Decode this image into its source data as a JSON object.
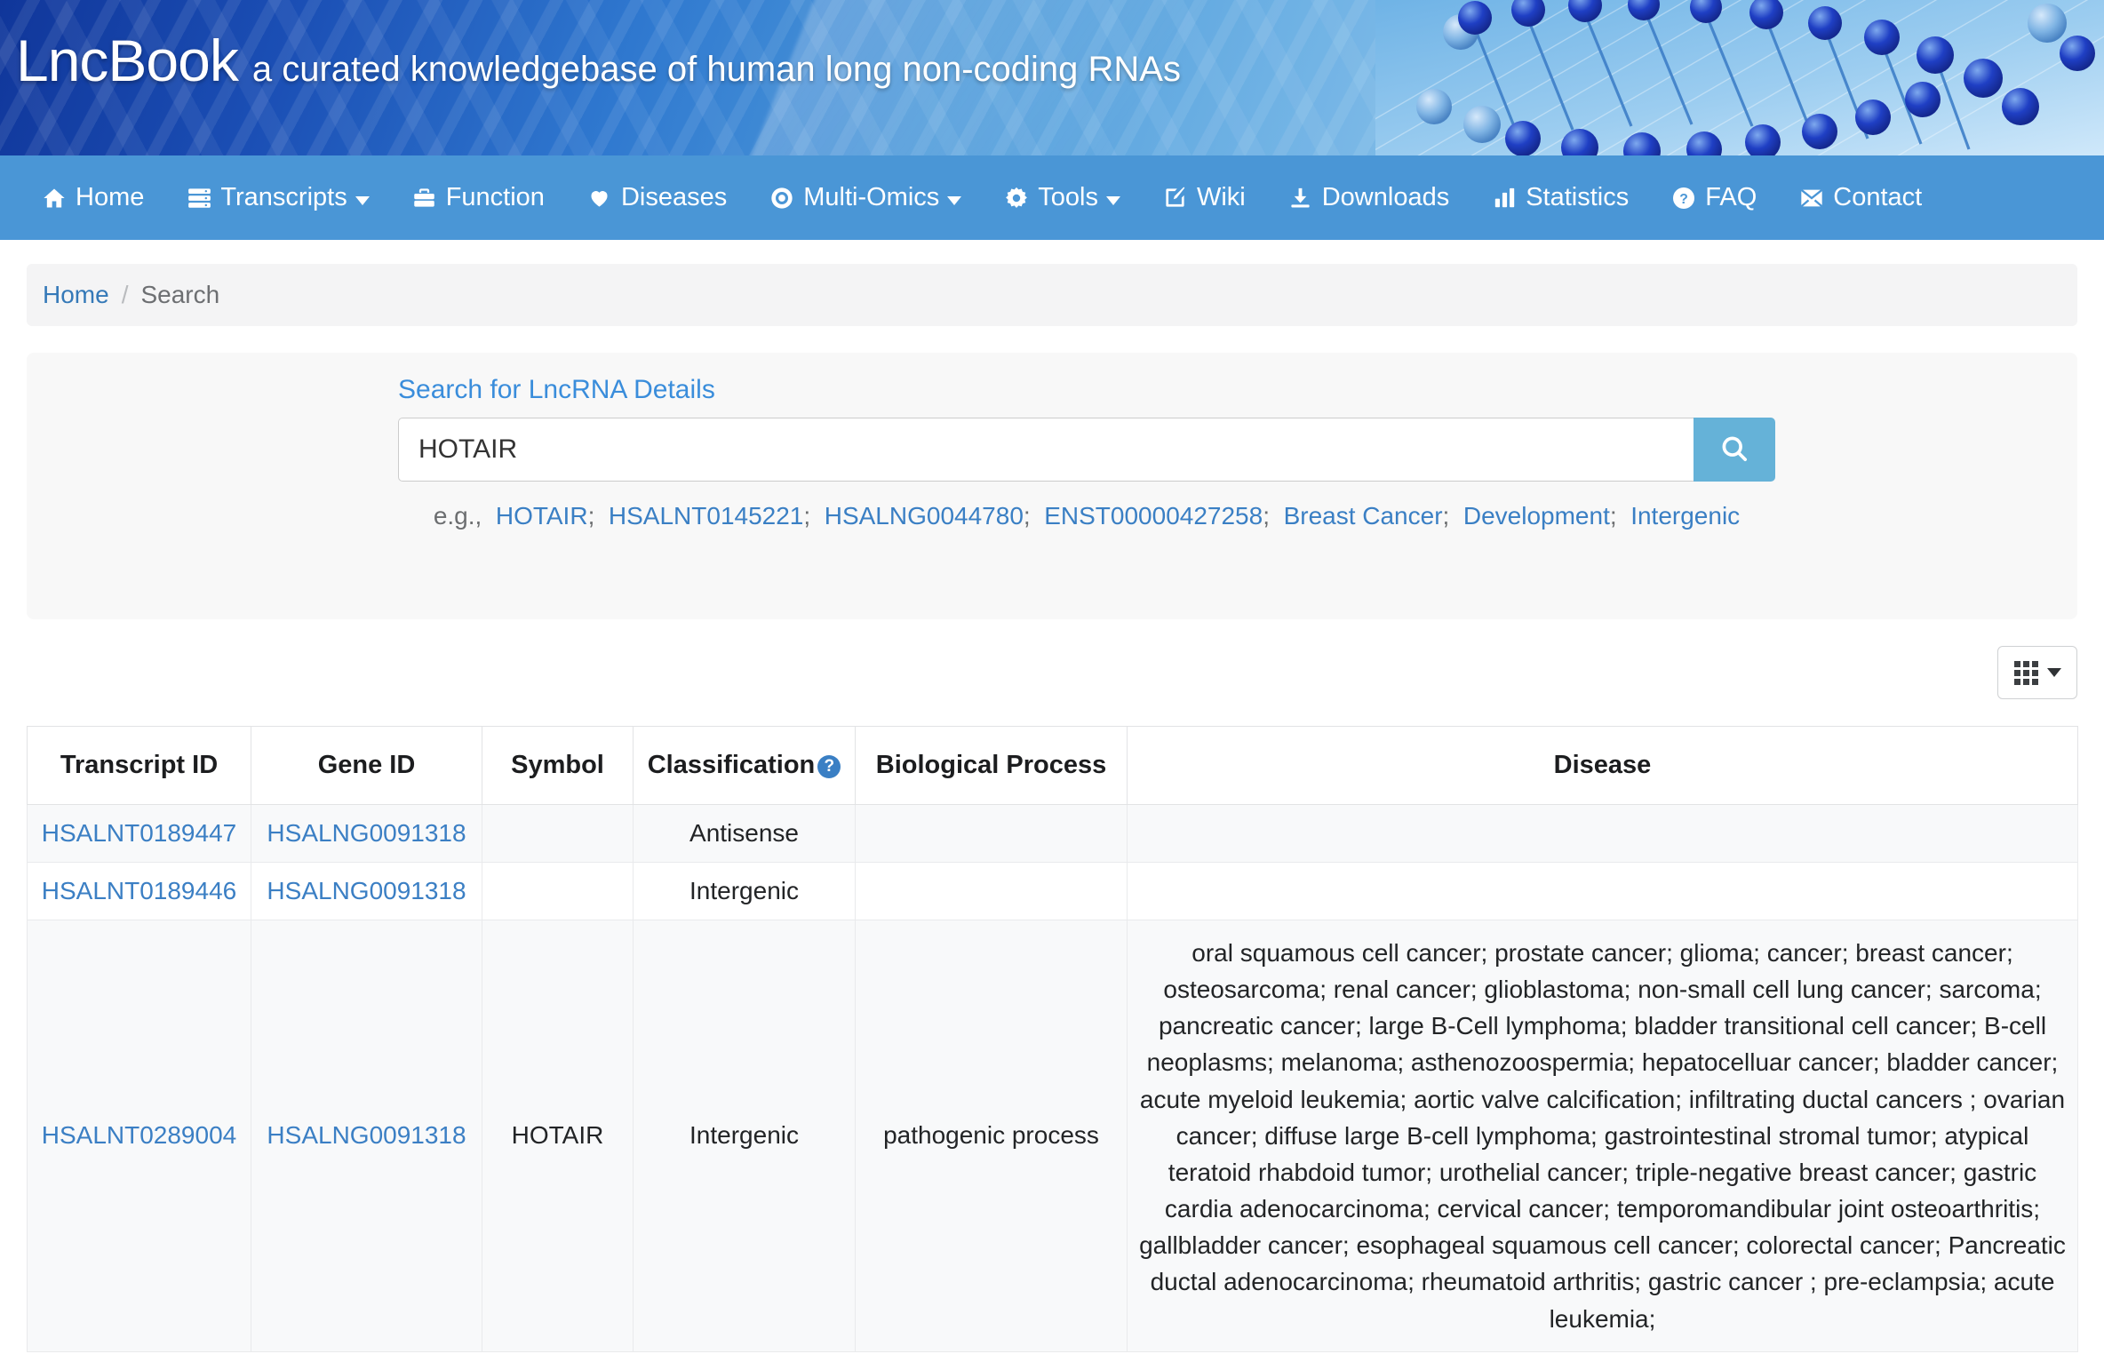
{
  "banner": {
    "logo": "LncBook",
    "tagline": "a curated knowledgebase of human long non-coding RNAs",
    "accent_color": "#4a96d6"
  },
  "nav": {
    "items": [
      {
        "label": "Home",
        "icon": "home-icon",
        "caret": false
      },
      {
        "label": "Transcripts",
        "icon": "server-icon",
        "caret": true
      },
      {
        "label": "Function",
        "icon": "briefcase-icon",
        "caret": false
      },
      {
        "label": "Diseases",
        "icon": "heart-icon",
        "caret": false
      },
      {
        "label": "Multi-Omics",
        "icon": "eye-icon",
        "caret": true
      },
      {
        "label": "Tools",
        "icon": "gear-icon",
        "caret": true
      },
      {
        "label": "Wiki",
        "icon": "edit-square-icon",
        "caret": false
      },
      {
        "label": "Downloads",
        "icon": "download-icon",
        "caret": false
      },
      {
        "label": "Statistics",
        "icon": "bar-chart-icon",
        "caret": false
      },
      {
        "label": "FAQ",
        "icon": "question-circle-icon",
        "caret": false
      },
      {
        "label": "Contact",
        "icon": "envelope-icon",
        "caret": false
      }
    ]
  },
  "breadcrumb": {
    "home": "Home",
    "separator": "/",
    "current": "Search"
  },
  "search": {
    "label": "Search for LncRNA Details",
    "value": "HOTAIR",
    "placeholder": "",
    "button_icon": "search-icon",
    "examples_prefix": "e.g.,",
    "examples": [
      "HOTAIR",
      "HSALNT0145221",
      "HSALNG0044780",
      "ENST00000427258",
      "Breast Cancer",
      "Development",
      "Intergenic"
    ]
  },
  "toolbar": {
    "column_toggle_icon": "grid-icon",
    "column_toggle_caret": "chevron-down-icon"
  },
  "table": {
    "columns": [
      "Transcript ID",
      "Gene ID",
      "Symbol",
      "Classification",
      "Biological Process",
      "Disease"
    ],
    "classification_help": "?",
    "rows": [
      {
        "transcript_id": "HSALNT0189447",
        "gene_id": "HSALNG0091318",
        "symbol": "",
        "classification": "Antisense",
        "biological_process": "",
        "disease": ""
      },
      {
        "transcript_id": "HSALNT0189446",
        "gene_id": "HSALNG0091318",
        "symbol": "",
        "classification": "Intergenic",
        "biological_process": "",
        "disease": ""
      },
      {
        "transcript_id": "HSALNT0289004",
        "gene_id": "HSALNG0091318",
        "symbol": "HOTAIR",
        "classification": "Intergenic",
        "biological_process": "pathogenic process",
        "disease": "oral squamous cell cancer; prostate cancer; glioma; cancer; breast cancer; osteosarcoma; renal cancer; glioblastoma; non-small cell lung cancer; sarcoma; pancreatic cancer; large B-Cell lymphoma; bladder transitional cell cancer; B-cell neoplasms; melanoma; asthenozoospermia; hepatocelluar cancer; bladder cancer; acute myeloid leukemia; aortic valve calcification; infiltrating ductal cancers ; ovarian cancer; diffuse large B-cell lymphoma; gastrointestinal stromal tumor; atypical teratoid rhabdoid tumor; urothelial cancer; triple-negative breast cancer; gastric cardia adenocarcinoma; cervical cancer; temporomandibular joint osteoarthritis; gallbladder cancer; esophageal squamous cell cancer; colorectal cancer; Pancreatic ductal adenocarcinoma; rheumatoid arthritis; gastric cancer ; pre-eclampsia; acute leukemia;"
      }
    ]
  }
}
